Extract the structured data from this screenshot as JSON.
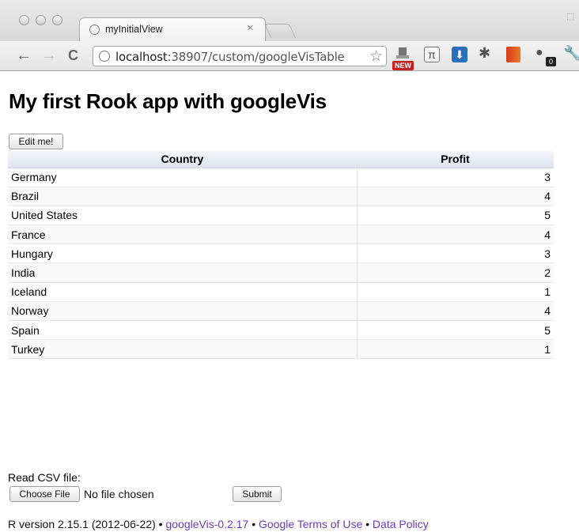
{
  "browser": {
    "tab_title": "myInitialView",
    "tab_close": "×",
    "url_host": "localhost",
    "url_path": ":38907/custom/googleVisTable",
    "new_badge": "NEW",
    "pi_symbol": "π",
    "badge_count": "0"
  },
  "page": {
    "title": "My first Rook app with googleVis",
    "edit_button": "Edit me!"
  },
  "table": {
    "headers": [
      "Country",
      "Profit"
    ],
    "rows": [
      {
        "country": "Germany",
        "profit": "3"
      },
      {
        "country": "Brazil",
        "profit": "4"
      },
      {
        "country": "United States",
        "profit": "5"
      },
      {
        "country": "France",
        "profit": "4"
      },
      {
        "country": "Hungary",
        "profit": "3"
      },
      {
        "country": "India",
        "profit": "2"
      },
      {
        "country": "Iceland",
        "profit": "1"
      },
      {
        "country": "Norway",
        "profit": "4"
      },
      {
        "country": "Spain",
        "profit": "5"
      },
      {
        "country": "Turkey",
        "profit": "1"
      }
    ]
  },
  "upload": {
    "label": "Read CSV file:",
    "choose_button": "Choose File",
    "no_file": "No file chosen",
    "submit_button": "Submit"
  },
  "footer": {
    "r_version": "R version 2.15.1 (2012-06-22)",
    "sep": "•",
    "googlevis_link": "googleVis-0.2.17",
    "terms_link": "Google Terms of Use",
    "policy_link": "Data Policy"
  },
  "colors": {
    "link": "#6a3bb5",
    "header_bg": "#dde3ee"
  }
}
